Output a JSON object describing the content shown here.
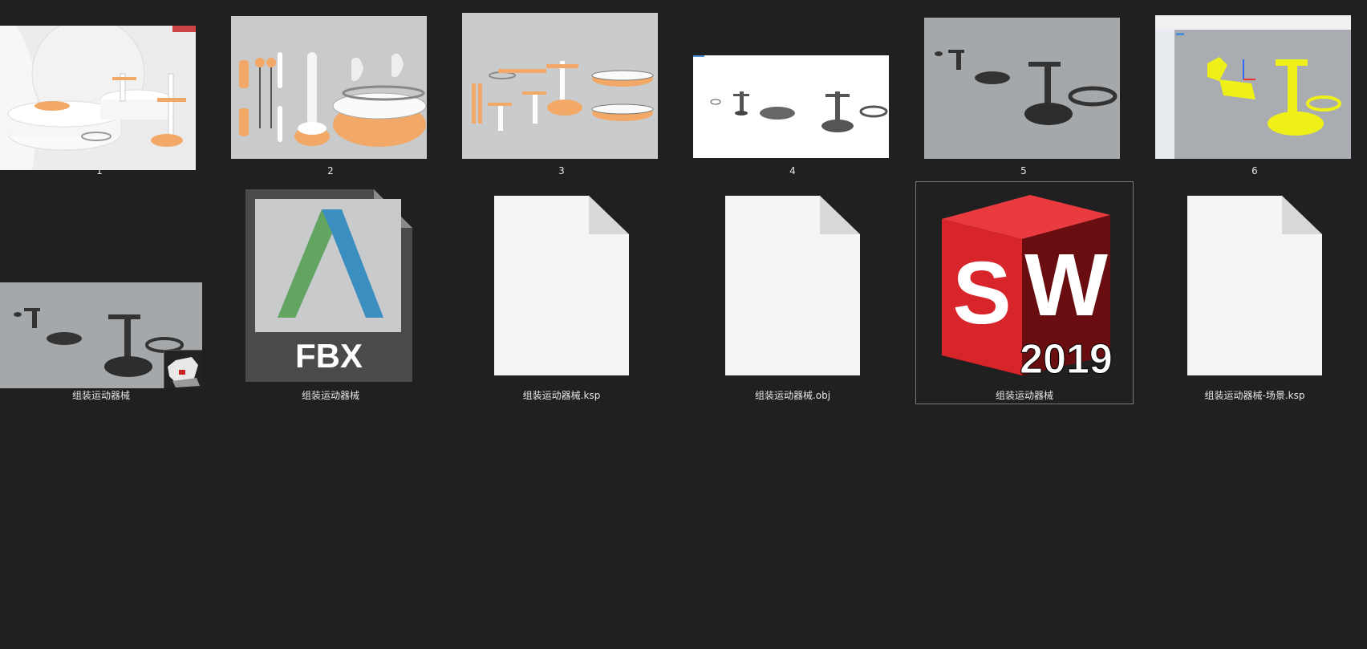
{
  "files": [
    {
      "label": "1"
    },
    {
      "label": "2"
    },
    {
      "label": "3"
    },
    {
      "label": "4"
    },
    {
      "label": "5"
    },
    {
      "label": "6"
    },
    {
      "label": "组装运动器械"
    },
    {
      "label": "组装运动器械",
      "icon_text": "FBX"
    },
    {
      "label": "组装运动器械.ksp"
    },
    {
      "label": "组装运动器械.obj"
    },
    {
      "label": "组装运动器械",
      "icon_letters": [
        "S",
        "W"
      ],
      "icon_year": "2019"
    },
    {
      "label": "组装运动器械-场景.ksp"
    }
  ],
  "colors": {
    "background": "#202020",
    "selection_border": "#7a7a7a",
    "render_orange": "#f2a866",
    "solidworks_red": "#d8242b"
  }
}
